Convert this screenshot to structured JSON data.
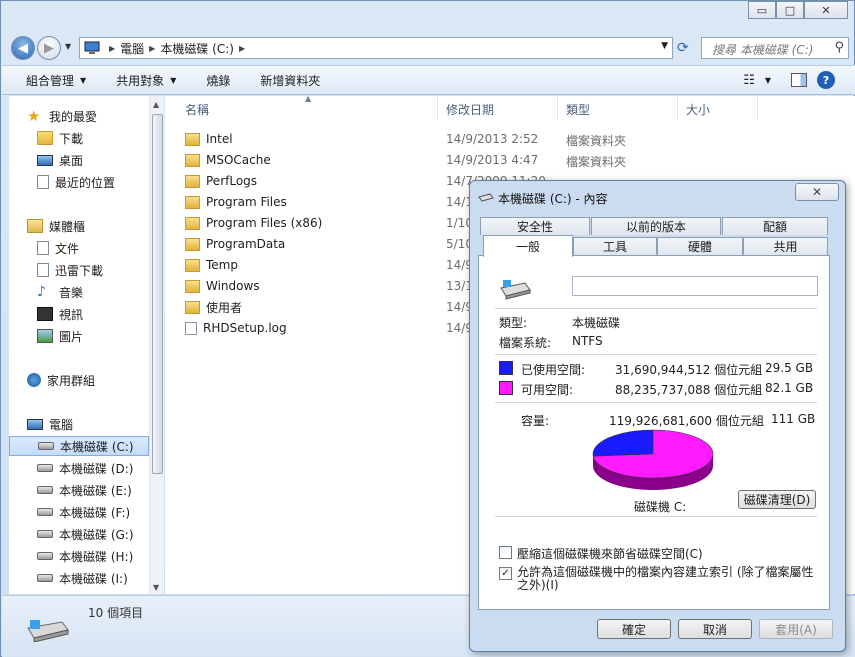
{
  "window": {
    "controls": {
      "minimize": "▭",
      "maximize": "□",
      "close": "✕"
    }
  },
  "address": {
    "crumbs": [
      "電腦",
      "本機磁碟 (C:)"
    ],
    "search_placeholder": "搜尋 本機磁碟 (C:)"
  },
  "toolbar": {
    "organize": "組合管理",
    "share": "共用對象",
    "burn": "燒錄",
    "new_folder": "新增資料夾"
  },
  "nav": {
    "favorites": "我的最愛",
    "downloads": "下載",
    "desktop": "桌面",
    "recent": "最近的位置",
    "libraries": "媒體櫃",
    "documents": "文件",
    "thunder": "迅雷下載",
    "music": "音樂",
    "videos": "視訊",
    "pictures": "圖片",
    "homegroup": "家用群組",
    "computer": "電腦",
    "drives": [
      "本機磁碟 (C:)",
      "本機磁碟 (D:)",
      "本機磁碟 (E:)",
      "本機磁碟 (F:)",
      "本機磁碟 (G:)",
      "本機磁碟 (H:)",
      "本機磁碟 (I:)"
    ]
  },
  "columns": {
    "name": "名稱",
    "date": "修改日期",
    "type": "類型",
    "size": "大小"
  },
  "files": [
    {
      "name": "Intel",
      "date": "14/9/2013 2:52",
      "type": "檔案資料夾"
    },
    {
      "name": "MSOCache",
      "date": "14/9/2013 4:47",
      "type": "檔案資料夾"
    },
    {
      "name": "PerfLogs",
      "date": "14/7/2009 11:20",
      "type": ""
    },
    {
      "name": "Program Files",
      "date": "14/1",
      "type": ""
    },
    {
      "name": "Program Files (x86)",
      "date": "1/10",
      "type": ""
    },
    {
      "name": "ProgramData",
      "date": "5/10",
      "type": ""
    },
    {
      "name": "Temp",
      "date": "14/9",
      "type": ""
    },
    {
      "name": "Windows",
      "date": "13/1",
      "type": ""
    },
    {
      "name": "使用者",
      "date": "14/9",
      "type": ""
    },
    {
      "name": "RHDSetup.log",
      "date": "14/9",
      "type": ""
    }
  ],
  "status": {
    "count": "10 個項目"
  },
  "dialog": {
    "title": "本機磁碟 (C:) - 內容",
    "close": "✕",
    "tabs_back": [
      "安全性",
      "以前的版本",
      "配額"
    ],
    "tabs_front": [
      "一般",
      "工具",
      "硬體",
      "共用"
    ],
    "type_label": "類型:",
    "type_value": "本機磁碟",
    "fs_label": "檔案系統:",
    "fs_value": "NTFS",
    "used_label": "已使用空間:",
    "used_bytes": "31,690,944,512 個位元組",
    "used_gb": "29.5 GB",
    "free_label": "可用空間:",
    "free_bytes": "88,235,737,088 個位元組",
    "free_gb": "82.1 GB",
    "cap_label": "容量:",
    "cap_bytes": "119,926,681,600 個位元組",
    "cap_gb": "111 GB",
    "drive_label": "磁碟機 C:",
    "cleanup": "磁碟清理(D)",
    "compress": "壓縮這個磁碟機來節省磁碟空間(C)",
    "index": "允許為這個磁碟機中的檔案內容建立索引 (除了檔案屬性之外)(I)",
    "compress_checked": false,
    "index_checked": true,
    "ok": "確定",
    "cancel": "取消",
    "apply": "套用(A)"
  },
  "colors": {
    "used": "#1a1aff",
    "free": "#ff1aff"
  },
  "chart_data": {
    "type": "pie",
    "categories": [
      "已使用空間",
      "可用空間"
    ],
    "values": [
      31690944512,
      88235737088
    ]
  }
}
